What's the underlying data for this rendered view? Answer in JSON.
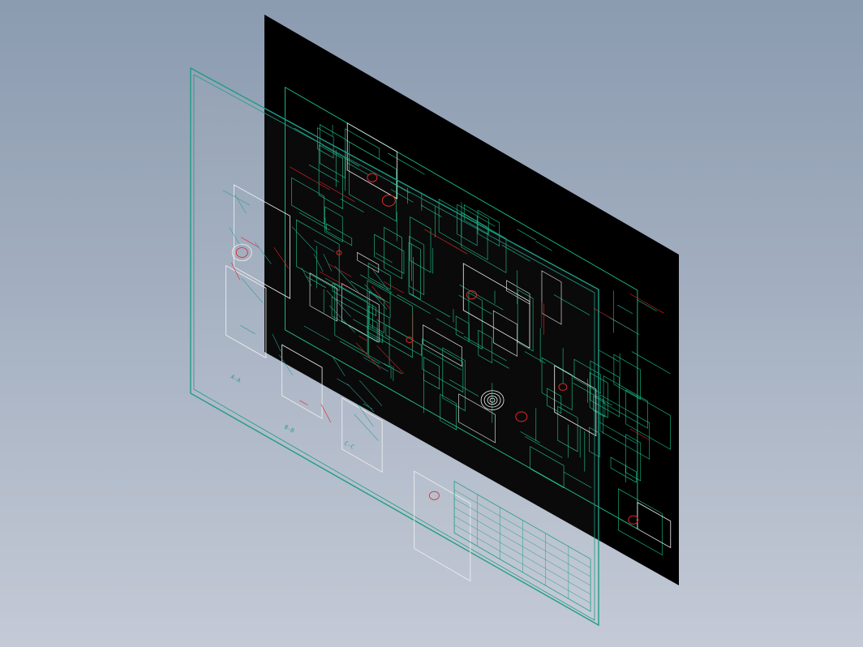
{
  "viewport": {
    "background_top": "#8b9bb0",
    "background_bottom": "#c4cad6"
  },
  "colors": {
    "black_plane": "#000000",
    "cad_green": "#19c28a",
    "cad_teal": "#2aa090",
    "cad_red": "#e02020",
    "cad_white": "#f2f2f2",
    "frame_teal": "#1f9c84"
  },
  "drawing_sheet": {
    "section_labels": [
      "A-A",
      "B-B",
      "C-C"
    ],
    "notes": "",
    "title_block_present": true
  },
  "icons": {
    "black_layer": "black-drawing-plane",
    "transparent_layer": "transparent-drawing-sheet"
  }
}
